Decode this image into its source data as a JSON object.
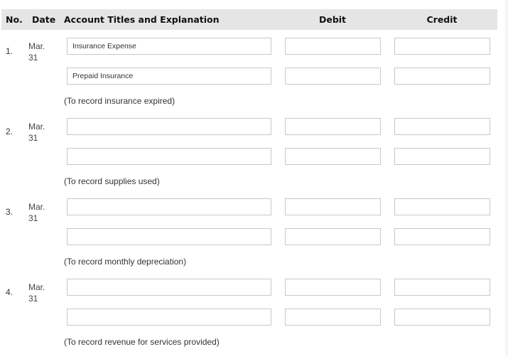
{
  "header": {
    "no": "No.",
    "date": "Date",
    "account": "Account Titles and Explanation",
    "debit": "Debit",
    "credit": "Credit"
  },
  "entries": [
    {
      "no": "1.",
      "date_month": "Mar.",
      "date_day": "31",
      "lines": [
        {
          "account": "Insurance Expense",
          "debit": "",
          "credit": ""
        },
        {
          "account": "Prepaid Insurance",
          "debit": "",
          "credit": ""
        }
      ],
      "explanation": "(To record insurance expired)"
    },
    {
      "no": "2.",
      "date_month": "Mar.",
      "date_day": "31",
      "lines": [
        {
          "account": "",
          "debit": "",
          "credit": ""
        },
        {
          "account": "",
          "debit": "",
          "credit": ""
        }
      ],
      "explanation": "(To record supplies used)"
    },
    {
      "no": "3.",
      "date_month": "Mar.",
      "date_day": "31",
      "lines": [
        {
          "account": "",
          "debit": "",
          "credit": ""
        },
        {
          "account": "",
          "debit": "",
          "credit": ""
        }
      ],
      "explanation": "(To record monthly depreciation)"
    },
    {
      "no": "4.",
      "date_month": "Mar.",
      "date_day": "31",
      "lines": [
        {
          "account": "",
          "debit": "",
          "credit": ""
        },
        {
          "account": "",
          "debit": "",
          "credit": ""
        }
      ],
      "explanation": "(To record revenue for services provided)"
    }
  ]
}
